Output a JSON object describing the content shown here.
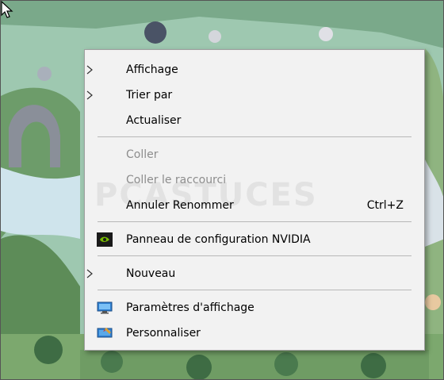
{
  "menu": {
    "items": [
      {
        "label": "Affichage"
      },
      {
        "label": "Trier par"
      },
      {
        "label": "Actualiser"
      },
      {
        "label": "Coller"
      },
      {
        "label": "Coller le raccourci"
      },
      {
        "label": "Annuler Renommer",
        "shortcut": "Ctrl+Z"
      },
      {
        "label": "Panneau de configuration NVIDIA",
        "icon": "nvidia-icon"
      },
      {
        "label": "Nouveau"
      },
      {
        "label": "Paramètres d'affichage",
        "icon": "display-settings-icon"
      },
      {
        "label": "Personnaliser",
        "icon": "personalize-icon"
      }
    ]
  },
  "watermark": {
    "text": "PCASTUCES"
  },
  "colors": {
    "menu_bg": "#f2f2f2",
    "disabled_text": "#8d8d8d",
    "nvidia_green": "#76b900"
  }
}
